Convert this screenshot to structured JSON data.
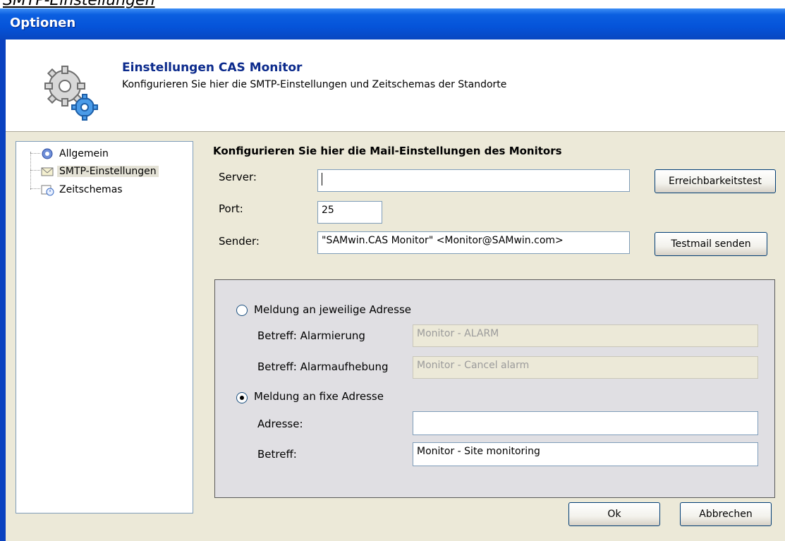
{
  "doc_caption": "SMTP-Einstellungen",
  "window": {
    "title": "Optionen"
  },
  "header": {
    "title": "Einstellungen CAS Monitor",
    "subtitle": "Konfigurieren Sie hier die SMTP-Einstellungen und Zeitschemas der Standorte"
  },
  "tree": {
    "items": [
      {
        "label": "Allgemein",
        "icon": "gear-icon",
        "selected": false
      },
      {
        "label": "SMTP-Einstellungen",
        "icon": "mail-icon",
        "selected": true
      },
      {
        "label": "Zeitschemas",
        "icon": "calendar-clock-icon",
        "selected": false
      }
    ]
  },
  "smtp": {
    "section_title": "Konfigurieren Sie hier die Mail-Einstellungen des Monitors",
    "server_label": "Server:",
    "server_value": "",
    "port_label": "Port:",
    "port_value": "25",
    "sender_label": "Sender:",
    "sender_value": "\"SAMwin.CAS Monitor\" <Monitor@SAMwin.com>",
    "reachability_button": "Erreichbarkeitstest",
    "testmail_button": "Testmail senden"
  },
  "notify": {
    "option_each": "Meldung an jeweilige Adresse",
    "subject_alarm_label": "Betreff: Alarmierung",
    "subject_alarm_value": "Monitor - ALARM",
    "subject_cancel_label": "Betreff: Alarmaufhebung",
    "subject_cancel_value": "Monitor - Cancel alarm",
    "option_fixed": "Meldung an fixe Adresse",
    "selected_option": "fixed",
    "address_label": "Adresse:",
    "address_value": "",
    "subject_label": "Betreff:",
    "subject_value": "Monitor - Site monitoring"
  },
  "footer": {
    "ok": "Ok",
    "cancel": "Abbrechen"
  }
}
